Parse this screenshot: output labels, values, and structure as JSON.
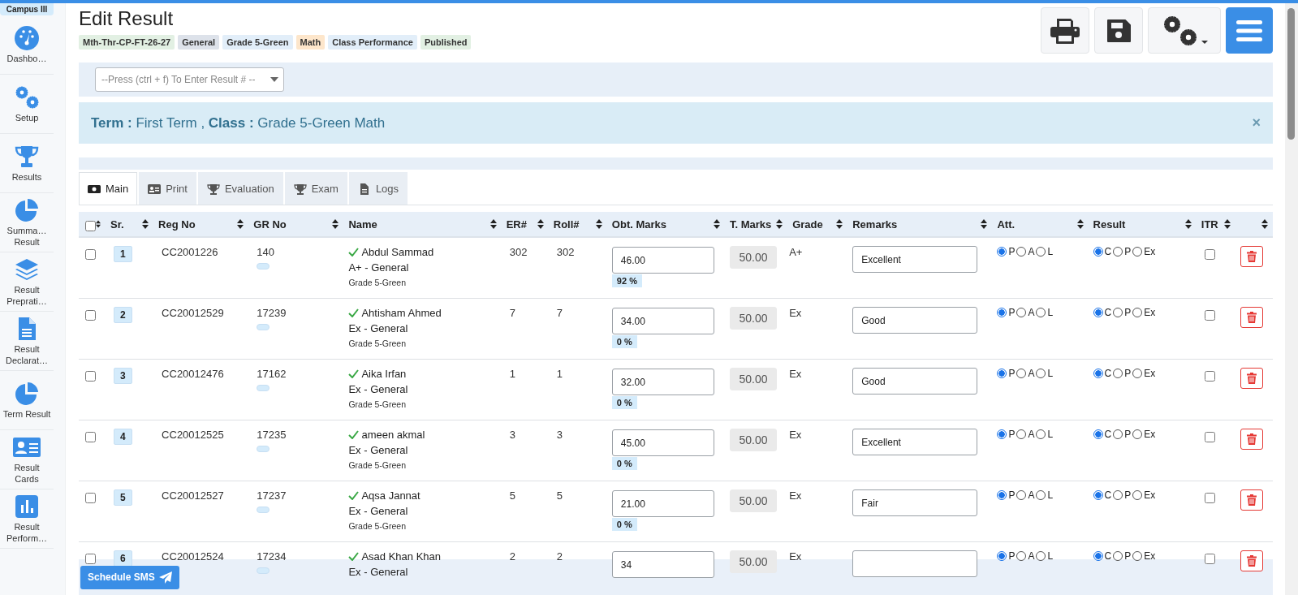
{
  "campus": "Campus III",
  "sidebar": {
    "items": [
      {
        "label": "Dashbo…",
        "selected": false
      },
      {
        "label": "Setup",
        "selected": false
      },
      {
        "label": "Results",
        "selected": false
      },
      {
        "label": "Summa… Result",
        "selected": false
      },
      {
        "label": "Result Preprati…",
        "selected": false
      },
      {
        "label": "Result Declarat…",
        "selected": false
      },
      {
        "label": "Term Result",
        "selected": false
      },
      {
        "label": "Result Cards",
        "selected": false
      },
      {
        "label": "Result Perform…",
        "selected": false
      }
    ]
  },
  "title": "Edit Result",
  "tags": [
    {
      "label": "Mth-Thr-CP-FT-26-27",
      "color": "#e2f0e3"
    },
    {
      "label": "General",
      "color": "#dde2ea"
    },
    {
      "label": "Grade 5-Green",
      "color": "#e2eef9"
    },
    {
      "label": "Math",
      "color": "#fde6cb"
    },
    {
      "label": "Class Performance",
      "color": "#e2eef9"
    },
    {
      "label": "Published",
      "color": "#e2f0e3"
    }
  ],
  "search": {
    "placeholder": "--Press (ctrl + f) To Enter Result # --"
  },
  "alert": {
    "text": "**Term :** First Term , **Class :** Grade 5-Green Math",
    "close": "×"
  },
  "tabs": [
    {
      "label": "Main",
      "selected": true
    },
    {
      "label": "Print",
      "selected": false
    },
    {
      "label": "Evaluation",
      "selected": false
    },
    {
      "label": "Exam",
      "selected": false
    },
    {
      "label": "Logs",
      "selected": false
    }
  ],
  "table": {
    "all_checked": false,
    "columns": [
      "Sr.",
      "Reg No",
      "GR No",
      "Name",
      "ER#",
      "Roll#",
      "Obt. Marks",
      "T. Marks",
      "Grade",
      "Remarks",
      "Att.",
      "Result",
      "ITR"
    ],
    "rows": [
      {
        "checked": false,
        "sr": "1",
        "reg_no": "CC2001226",
        "gr_no": "140",
        "verified": true,
        "name": "Abdul Sammad",
        "grade_line": "A+ - General",
        "class_line": "Grade 5-Green",
        "er": "302",
        "roll": "302",
        "obt_marks": "46.00",
        "percent": "92 %",
        "t_marks": "50.00",
        "grade": "A+",
        "remarks": "Excellent",
        "attendance": [
          {
            "label": "P",
            "selected": true
          },
          {
            "label": "A",
            "selected": false
          },
          {
            "label": "L",
            "selected": false
          }
        ],
        "result": [
          {
            "label": "C",
            "selected": true
          },
          {
            "label": "P",
            "selected": false
          },
          {
            "label": "Ex",
            "selected": false
          }
        ],
        "itr": false
      },
      {
        "checked": false,
        "sr": "2",
        "reg_no": "CC20012529",
        "gr_no": "17239",
        "verified": true,
        "name": "Ahtisham Ahmed",
        "grade_line": "Ex - General",
        "class_line": "Grade 5-Green",
        "er": "7",
        "roll": "7",
        "obt_marks": "34.00",
        "percent": "0 %",
        "t_marks": "50.00",
        "grade": "Ex",
        "remarks": "Good",
        "attendance": [
          {
            "label": "P",
            "selected": true
          },
          {
            "label": "A",
            "selected": false
          },
          {
            "label": "L",
            "selected": false
          }
        ],
        "result": [
          {
            "label": "C",
            "selected": true
          },
          {
            "label": "P",
            "selected": false
          },
          {
            "label": "Ex",
            "selected": false
          }
        ],
        "itr": false
      },
      {
        "checked": false,
        "sr": "3",
        "reg_no": "CC20012476",
        "gr_no": "17162",
        "verified": true,
        "name": "Aika Irfan",
        "grade_line": "Ex - General",
        "class_line": "Grade 5-Green",
        "er": "1",
        "roll": "1",
        "obt_marks": "32.00",
        "percent": "0 %",
        "t_marks": "50.00",
        "grade": "Ex",
        "remarks": "Good",
        "attendance": [
          {
            "label": "P",
            "selected": true
          },
          {
            "label": "A",
            "selected": false
          },
          {
            "label": "L",
            "selected": false
          }
        ],
        "result": [
          {
            "label": "C",
            "selected": true
          },
          {
            "label": "P",
            "selected": false
          },
          {
            "label": "Ex",
            "selected": false
          }
        ],
        "itr": false
      },
      {
        "checked": false,
        "sr": "4",
        "reg_no": "CC20012525",
        "gr_no": "17235",
        "verified": true,
        "name": "ameen akmal",
        "grade_line": "Ex - General",
        "class_line": "Grade 5-Green",
        "er": "3",
        "roll": "3",
        "obt_marks": "45.00",
        "percent": "0 %",
        "t_marks": "50.00",
        "grade": "Ex",
        "remarks": "Excellent",
        "attendance": [
          {
            "label": "P",
            "selected": true
          },
          {
            "label": "A",
            "selected": false
          },
          {
            "label": "L",
            "selected": false
          }
        ],
        "result": [
          {
            "label": "C",
            "selected": true
          },
          {
            "label": "P",
            "selected": false
          },
          {
            "label": "Ex",
            "selected": false
          }
        ],
        "itr": false
      },
      {
        "checked": false,
        "sr": "5",
        "reg_no": "CC20012527",
        "gr_no": "17237",
        "verified": true,
        "name": "Aqsa Jannat",
        "grade_line": "Ex - General",
        "class_line": "Grade 5-Green",
        "er": "5",
        "roll": "5",
        "obt_marks": "21.00",
        "percent": "0 %",
        "t_marks": "50.00",
        "grade": "Ex",
        "remarks": "Fair",
        "attendance": [
          {
            "label": "P",
            "selected": true
          },
          {
            "label": "A",
            "selected": false
          },
          {
            "label": "L",
            "selected": false
          }
        ],
        "result": [
          {
            "label": "C",
            "selected": true
          },
          {
            "label": "P",
            "selected": false
          },
          {
            "label": "Ex",
            "selected": false
          }
        ],
        "itr": false
      },
      {
        "checked": false,
        "sr": "6",
        "reg_no": "CC20012524",
        "gr_no": "17234",
        "verified": true,
        "name": "Asad Khan Khan",
        "grade_line": "Ex - General",
        "er": "2",
        "roll": "2",
        "obt_marks": "34",
        "t_marks": "50.00",
        "grade": "Ex",
        "attendance": [
          {
            "label": "P",
            "selected": true
          },
          {
            "label": "A",
            "selected": false
          },
          {
            "label": "L",
            "selected": false
          }
        ],
        "result": [
          {
            "label": "C",
            "selected": true
          },
          {
            "label": "P",
            "selected": false
          },
          {
            "label": "Ex",
            "selected": false
          }
        ],
        "itr": false
      }
    ]
  },
  "footer": {
    "button": "Schedule SMS"
  }
}
